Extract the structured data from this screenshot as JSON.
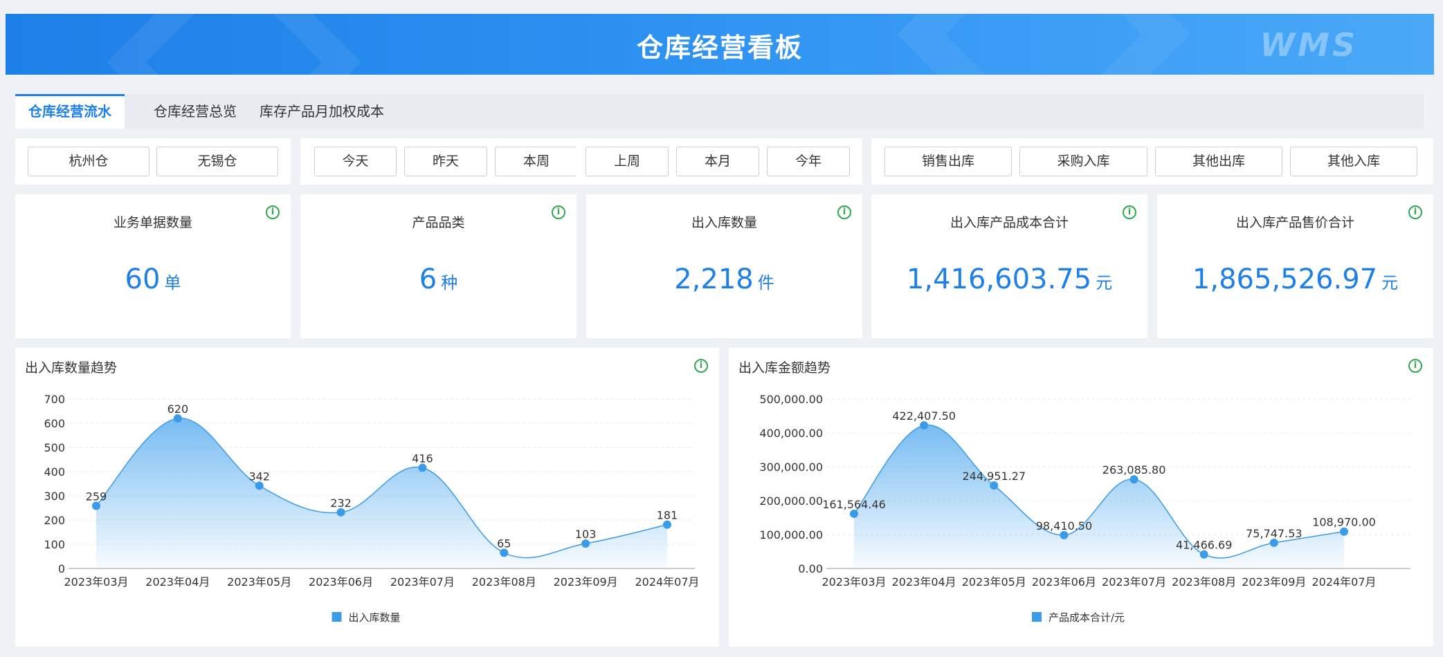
{
  "header": {
    "title": "仓库经营看板",
    "logo_text": "WMS"
  },
  "tabs": [
    {
      "label": "仓库经营流水",
      "active": true
    },
    {
      "label": "仓库经营总览",
      "active": false
    },
    {
      "label": "库存产品月加权成本",
      "active": false
    }
  ],
  "filters": {
    "warehouses": [
      "杭州仓",
      "无锡仓"
    ],
    "periods": [
      "今天",
      "昨天",
      "本周",
      "上周",
      "本月",
      "今年"
    ],
    "types": [
      "销售出库",
      "采购入库",
      "其他出库",
      "其他入库"
    ]
  },
  "kpis": [
    {
      "title": "业务单据数量",
      "value": "60",
      "unit": "单"
    },
    {
      "title": "产品品类",
      "value": "6",
      "unit": "种"
    },
    {
      "title": "出入库数量",
      "value": "2,218",
      "unit": "件"
    },
    {
      "title": "出入库产品成本合计",
      "value": "1,416,603.75",
      "unit": "元"
    },
    {
      "title": "出入库产品售价合计",
      "value": "1,865,526.97",
      "unit": "元"
    }
  ],
  "info_icon": "info-circle-icon",
  "colors": {
    "accent": "#1e7fe8",
    "series": "#3a9be8",
    "info": "#2fa84f",
    "header": "#2b8ff0"
  },
  "chart_data": [
    {
      "type": "area",
      "title": "出入库数量趋势",
      "categories": [
        "2023年03月",
        "2023年04月",
        "2023年05月",
        "2023年06月",
        "2023年07月",
        "2023年08月",
        "2023年09月",
        "2024年07月"
      ],
      "series": [
        {
          "name": "出入库数量",
          "values": [
            259,
            620,
            342,
            232,
            416,
            65,
            103,
            181
          ]
        }
      ],
      "value_labels": [
        "259",
        "620",
        "342",
        "232",
        "416",
        "65",
        "103",
        "181"
      ],
      "y_ticks": [
        "0",
        "100",
        "200",
        "300",
        "400",
        "500",
        "600",
        "700"
      ],
      "ylim": [
        0,
        700
      ],
      "smooth": true,
      "legend": "bottom-center"
    },
    {
      "type": "area",
      "title": "出入库金额趋势",
      "categories": [
        "2023年03月",
        "2023年04月",
        "2023年05月",
        "2023年06月",
        "2023年07月",
        "2023年08月",
        "2023年09月",
        "2024年07月"
      ],
      "series": [
        {
          "name": "产品成本合计/元",
          "values": [
            161564.46,
            422407.5,
            244951.27,
            98410.5,
            263085.8,
            41466.69,
            75747.53,
            108970.0
          ]
        }
      ],
      "value_labels": [
        "161,564.46",
        "422,407.50",
        "244,951.27",
        "98,410.50",
        "263,085.80",
        "41,466.69",
        "75,747.53",
        "108,970.00"
      ],
      "y_ticks": [
        "0.00",
        "100,000.00",
        "200,000.00",
        "300,000.00",
        "400,000.00",
        "500,000.00"
      ],
      "ylim": [
        0,
        500000
      ],
      "smooth": true,
      "legend": "bottom-center"
    }
  ]
}
